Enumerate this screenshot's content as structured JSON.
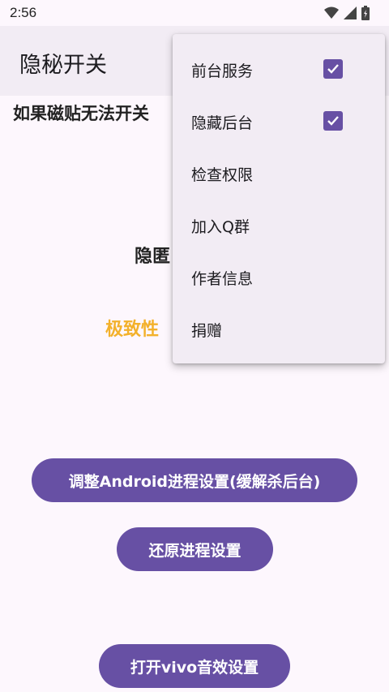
{
  "status_bar": {
    "time": "2:56",
    "icons": [
      "wifi-icon",
      "signal-icon",
      "battery-icon"
    ]
  },
  "app_bar": {
    "title": "隐秘开关"
  },
  "content": {
    "tile_line": "如果磁贴无法开关",
    "hide_line": "隐匿",
    "perf_line": "极致性",
    "perf_color": "#f3b12b"
  },
  "buttons": {
    "adjust": "调整Android进程设置(缓解杀后台)",
    "restore": "还原进程设置",
    "vivo": "打开vivo音效设置",
    "accent": "#6750a4"
  },
  "menu": {
    "items": [
      {
        "label": "前台服务",
        "checked": true
      },
      {
        "label": "隐藏后台",
        "checked": true
      },
      {
        "label": "检查权限"
      },
      {
        "label": "加入Q群"
      },
      {
        "label": "作者信息"
      },
      {
        "label": "捐赠"
      }
    ]
  }
}
